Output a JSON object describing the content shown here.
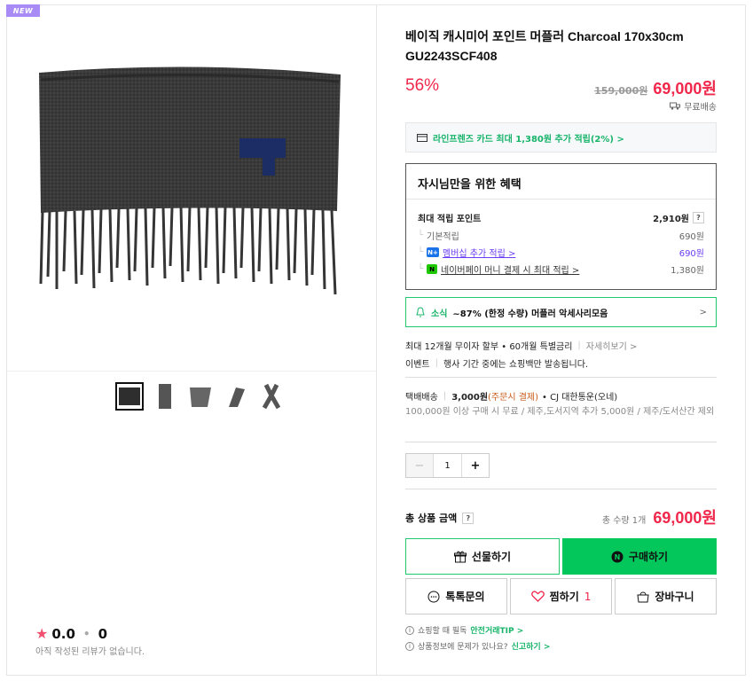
{
  "badge": "NEW",
  "product": {
    "title": "베이직 캐시미어 포인트 머플러 Charcoal 170x30cm GU2243SCF408",
    "discount_rate": "56%",
    "original_price": "159,000원",
    "sale_price": "69,000원",
    "shipping_label": "무료배송"
  },
  "card_offer": "라인프렌즈 카드 최대 1,380원 추가 적립(2%) >",
  "benefits": {
    "heading": "자시님만을 위한 혜택",
    "max_points_label": "최대 적립 포인트",
    "max_points_value": "2,910원",
    "rows": [
      {
        "label": "기본적립",
        "value": "690원"
      },
      {
        "label": "멤버십 추가 적립 >",
        "value": "690원"
      },
      {
        "label": "네이버페이 머니 결제 시 최대 적립 >",
        "value": "1,380원"
      }
    ],
    "badge_n_plus": "N+",
    "badge_n": "N",
    "help": "?"
  },
  "news": {
    "label": "소식",
    "text": "~87% (한정 수량) 머플러 악세사리모음",
    "chevron": ">"
  },
  "installment": {
    "text": "최대 12개월 무이자 할부 • 60개월 특별금리",
    "link": "자세히보기 >"
  },
  "event": {
    "label": "이벤트",
    "text": "행사 기간 중에는 쇼핑백만 발송됩니다."
  },
  "delivery": {
    "label": "택배배송",
    "fee": "3,000원",
    "fee_note": "(주문시 결제)",
    "carrier": "• CJ 대한통운(오네)",
    "note": "100,000원 이상 구매 시 무료 / 제주,도서지역 추가 5,000원 / 제주/도서산간 제외"
  },
  "quantity": {
    "minus": "−",
    "value": "1",
    "plus": "+"
  },
  "total": {
    "label": "총 상품 금액",
    "help": "?",
    "count": "총 수량 1개",
    "price": "69,000원"
  },
  "buttons": {
    "gift": "선물하기",
    "buy": "구매하기",
    "talk": "톡톡문의",
    "wish": "찜하기",
    "wish_count": "1",
    "cart": "장바구니"
  },
  "tips": {
    "safe_prefix": "쇼핑할 때 필독",
    "safe_link": "안전거래TIP >",
    "report_prefix": "상품정보에 문제가 있나요?",
    "report_link": "신고하기 >"
  },
  "review": {
    "rating": "0.0",
    "count": "0",
    "empty": "아직 작성된 리뷰가 없습니다."
  },
  "colors": {
    "accent_red": "#f0274b",
    "naver_green": "#03c75a",
    "badge_purple": "#a88bf5"
  }
}
